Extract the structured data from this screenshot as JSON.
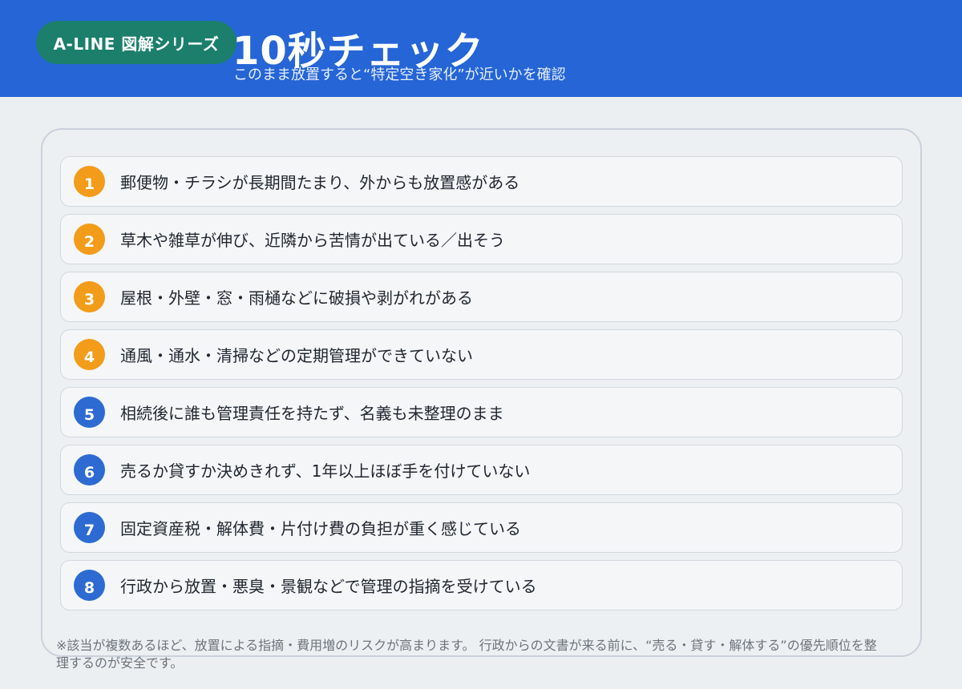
{
  "header": {
    "badge": "A-LINE 図解シリーズ",
    "title": "10秒チェック",
    "subtitle": "このまま放置すると“特定空き家化”が近いかを確認"
  },
  "colors": {
    "header_bg": "#2565d6",
    "badge_bg": "#1b7f6c",
    "number_orange": "#f29c1a",
    "number_blue": "#2d6bd2"
  },
  "checklist": [
    {
      "number": "1",
      "color": "orange",
      "text": "郵便物・チラシが長期間たまり、外からも放置感がある"
    },
    {
      "number": "2",
      "color": "orange",
      "text": "草木や雑草が伸び、近隣から苦情が出ている／出そう"
    },
    {
      "number": "3",
      "color": "orange",
      "text": "屋根・外壁・窓・雨樋などに破損や剥がれがある"
    },
    {
      "number": "4",
      "color": "orange",
      "text": "通風・通水・清掃などの定期管理ができていない"
    },
    {
      "number": "5",
      "color": "blue",
      "text": "相続後に誰も管理責任を持たず、名義も未整理のまま"
    },
    {
      "number": "6",
      "color": "blue",
      "text": "売るか貸すか決めきれず、1年以上ほぼ手を付けていない"
    },
    {
      "number": "7",
      "color": "blue",
      "text": "固定資産税・解体費・片付け費の負担が重く感じている"
    },
    {
      "number": "8",
      "color": "blue",
      "text": "行政から放置・悪臭・景観などで管理の指摘を受けている"
    }
  ],
  "footnote": "※該当が複数あるほど、放置による指摘・費用増のリスクが高まります。 行政からの文書が来る前に、“売る・貸す・解体する”の優先順位を整理するのが安全です。"
}
